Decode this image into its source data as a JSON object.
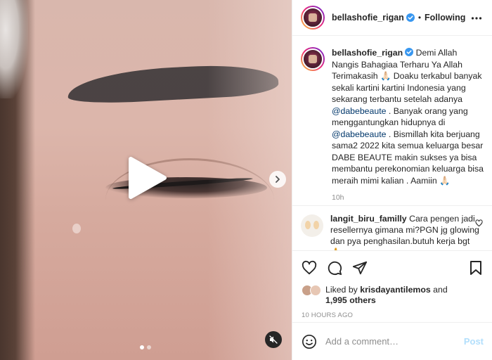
{
  "header": {
    "username": "bellashofie_rigan",
    "separator": "•",
    "follow_label": "Following"
  },
  "caption": {
    "username": "bellashofie_rigan",
    "text_1": "Demi Allah Nangis Bahagiaa Terharu Ya Allah Terimakasih 🙏🏻 Doaku terkabul banyak sekali kartini kartini Indonesia yang sekarang terbantu setelah adanya",
    "mention_1": "@dabebeaute",
    "text_2": ". Banyak orang yang menggantungkan hidupnya di",
    "mention_2": "@dabebeaute",
    "text_3": ". Bismillah kita berjuang sama2 2022 kita semua keluarga besar DABE BEAUTE makin sukses ya bisa membantu perekonomian keluarga bisa meraih mimi kalian . Aamiin 🙏🏻",
    "time": "10h"
  },
  "comment": {
    "username": "langit_biru_familly",
    "text": "Cara pengen jadi resellernya gimana mi?PGN jg glowing dan pya penghasilan.butuh kerja bgt 🙏"
  },
  "likes": {
    "prefix": "Liked by",
    "user": "krisdayantilemos",
    "and": "and",
    "count": "1,995 others"
  },
  "timestamp": "10 HOURS AGO",
  "add_comment": {
    "placeholder": "Add a comment…",
    "post_label": "Post"
  },
  "media": {
    "carousel_total": 2,
    "carousel_active": 1
  },
  "colors": {
    "verified": "#3897f0",
    "mention": "#00376b",
    "post_disabled": "#b2dffc",
    "muted": "#8e8e8e"
  }
}
